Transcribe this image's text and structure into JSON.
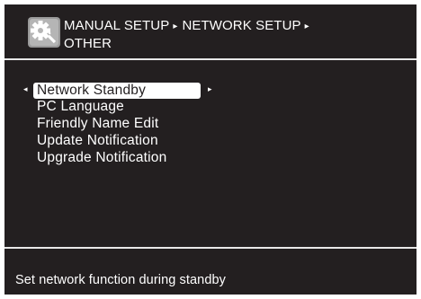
{
  "header": {
    "icon": "gear-wrench-icon",
    "breadcrumb": [
      "MANUAL SETUP",
      "NETWORK SETUP",
      "OTHER"
    ],
    "separator": "▸"
  },
  "menu": {
    "items": [
      {
        "label": "Network Standby",
        "selected": true
      },
      {
        "label": "PC Language",
        "selected": false
      },
      {
        "label": "Friendly Name Edit",
        "selected": false
      },
      {
        "label": "Update Notification",
        "selected": false
      },
      {
        "label": "Upgrade Notification",
        "selected": false
      }
    ],
    "left_arrow": "◂",
    "right_arrow": "▸"
  },
  "footer": {
    "help_text": "Set network function during standby"
  },
  "colors": {
    "background": "#231f20",
    "text": "#ffffff",
    "highlight": "#ffffff",
    "divider": "#e8e8e8"
  }
}
